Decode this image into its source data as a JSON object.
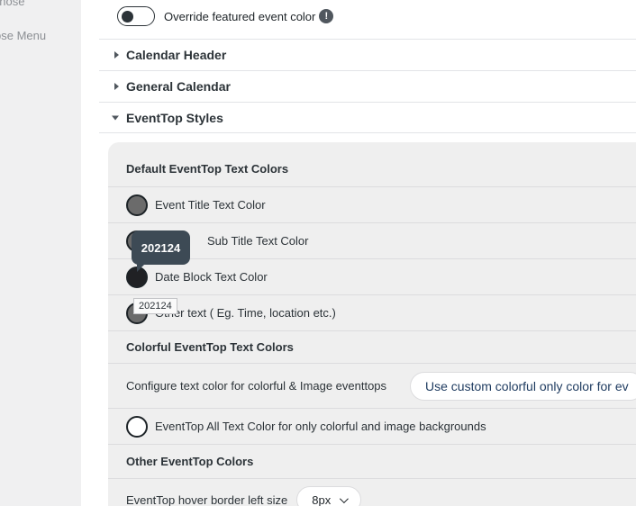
{
  "sidebar": {
    "diagnose_label": "gnose",
    "collapse_label": "pse Menu"
  },
  "featured": {
    "toggle_label": "Override featured event color",
    "info": "!"
  },
  "sections": [
    {
      "title": "Calendar Header",
      "expanded": false
    },
    {
      "title": "General Calendar",
      "expanded": false
    },
    {
      "title": "EventTop Styles",
      "expanded": true
    }
  ],
  "eventtop": {
    "default_colors_title": "Default EventTop Text Colors",
    "color_rows": [
      {
        "label": "Event Title Text Color",
        "color": "#6b6b6b"
      },
      {
        "label": "Sub Title Text Color",
        "color": "#6b6b6b"
      },
      {
        "label": "Date Block Text Color",
        "color": "#202124"
      },
      {
        "label": "Other text ( Eg. Time, location etc.)",
        "color": "#6b6b6b"
      }
    ],
    "colorful_title": "Colorful EventTop Text Colors",
    "configure_label": "Configure text color for colorful & Image eventtops",
    "configure_button": "Use custom colorful only color for ev",
    "all_text_label": "EventTop All Text Color for only colorful and image backgrounds",
    "all_text_color": "#ffffff",
    "other_title": "Other EventTop Colors",
    "hover_border_label": "EventTop hover border left size",
    "hover_border_value": "8px"
  },
  "tooltip": {
    "bubble_text": "202124",
    "small_text": "202124"
  }
}
